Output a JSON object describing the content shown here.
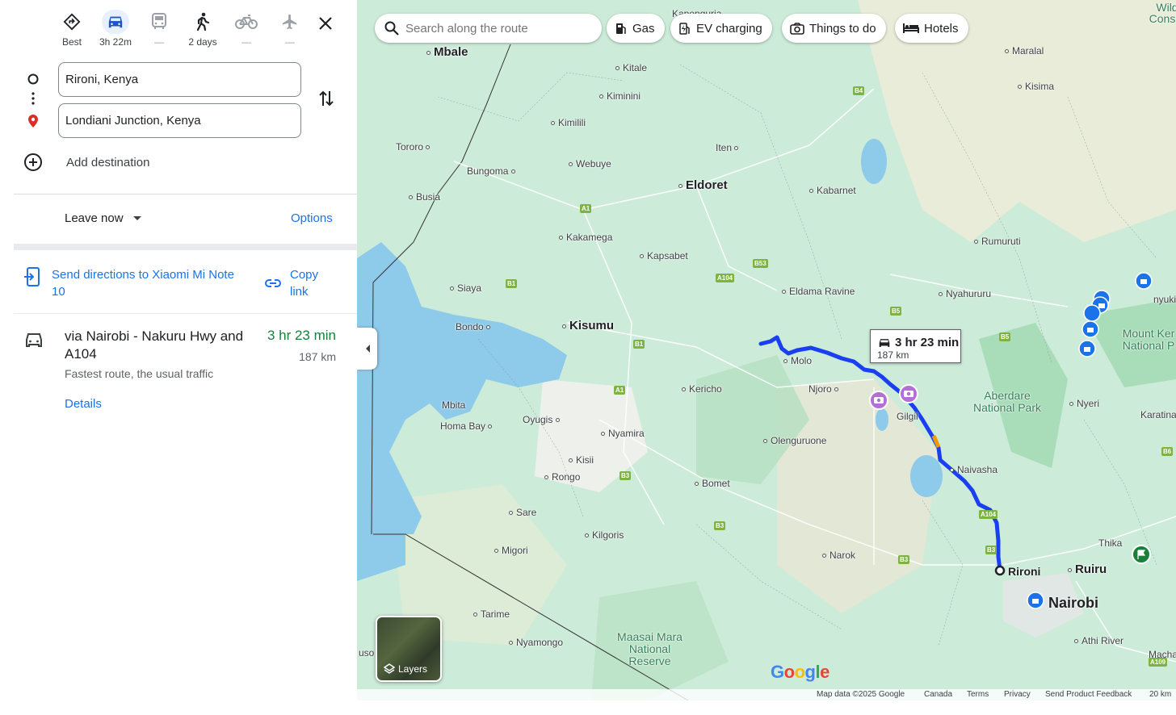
{
  "travel_modes": [
    {
      "name": "best",
      "icon": "best-route-icon",
      "label": "Best",
      "active": false
    },
    {
      "name": "driving",
      "icon": "car-icon",
      "label": "3h 22m",
      "active": true
    },
    {
      "name": "transit",
      "icon": "transit-icon",
      "label": "—",
      "active": false
    },
    {
      "name": "walking",
      "icon": "walking-icon",
      "label": "2 days",
      "active": false
    },
    {
      "name": "cycling",
      "icon": "bicycle-icon",
      "label": "—",
      "active": false
    },
    {
      "name": "flights",
      "icon": "airplane-icon",
      "label": "—",
      "active": false
    }
  ],
  "waypoints": {
    "origin": "Rironi, Kenya",
    "destination": "Londiani Junction, Kenya",
    "add_destination": "Add destination"
  },
  "departure": {
    "leave_label": "Leave now",
    "options_label": "Options"
  },
  "share": {
    "send_label": "Send directions to Xiaomi Mi Note 10",
    "copy_label": "Copy link"
  },
  "route": {
    "name": "via Nairobi - Nakuru Hwy and A104",
    "duration": "3 hr 23 min",
    "distance": "187 km",
    "description": "Fastest route, the usual traffic",
    "details_label": "Details"
  },
  "map": {
    "search_placeholder": "Search along the route",
    "chips": [
      {
        "label": "Gas",
        "icon": "gas-station-icon"
      },
      {
        "label": "EV charging",
        "icon": "ev-charging-icon"
      },
      {
        "label": "Things to do",
        "icon": "camera-icon"
      },
      {
        "label": "Hotels",
        "icon": "bed-icon"
      }
    ],
    "route_callout": {
      "duration": "3 hr 23 min",
      "distance": "187 km"
    },
    "layers_label": "Layers",
    "colors": {
      "route": "#1a3ff0",
      "water": "#8ecae9",
      "land": "#cdebd9",
      "park": "#a9dcb8"
    },
    "places": {
      "mbale": "Mbale",
      "kapenguria": "Kapenguria",
      "kitale": "Kitale",
      "kiminini": "Kiminini",
      "kimilili": "Kimilili",
      "tororo": "Tororo",
      "bungoma": "Bungoma",
      "webuye": "Webuye",
      "busia": "Busia",
      "iten": "Iten",
      "eldoret": "Eldoret",
      "kabarnet": "Kabarnet",
      "kakamega": "Kakamega",
      "kapsabet": "Kapsabet",
      "siaya": "Siaya",
      "bondo": "Bondo",
      "kisumu": "Kisumu",
      "eldama_ravine": "Eldama Ravine",
      "nyahururu": "Nyahururu",
      "rumuruti": "Rumuruti",
      "maralal": "Maralal",
      "kisima": "Kisima",
      "molo": "Molo",
      "njoro": "Njoro",
      "kericho": "Kericho",
      "gilgil": "Gilgil",
      "mbita": "Mbita",
      "homa_bay": "Homa Bay",
      "oyugis": "Oyugis",
      "nyamira": "Nyamira",
      "olenguruone": "Olenguruone",
      "naivasha": "Naivasha",
      "kisii": "Kisii",
      "rongo": "Rongo",
      "bomet": "Bomet",
      "sare": "Sare",
      "kilgoris": "Kilgoris",
      "migori": "Migori",
      "narok": "Narok",
      "rironi": "Rironi",
      "nairobi": "Nairobi",
      "ruiru": "Ruiru",
      "thika": "Thika",
      "nyeri": "Nyeri",
      "karatina": "Karatina",
      "athi_river": "Athi River",
      "tarime": "Tarime",
      "nyamongo": "Nyamongo",
      "nyuki": "nyuki",
      "macha": "Macha",
      "uso": "uso",
      "wild": "Wild",
      "cons": "Cons"
    },
    "parks": {
      "aberdare": "Aberdare National Park",
      "maasai_mara": "Maasai Mara National Reserve",
      "mount_kenya": "Mount Ker National P"
    },
    "highways": [
      "B4",
      "A1",
      "B53",
      "A104",
      "B1",
      "B5",
      "B1",
      "A1",
      "B3",
      "A104",
      "B3",
      "B3",
      "B3",
      "B6",
      "A109"
    ]
  },
  "footer": {
    "map_data": "Map data ©2025 Google",
    "country": "Canada",
    "terms": "Terms",
    "privacy": "Privacy",
    "feedback": "Send Product Feedback",
    "scale": "20 km"
  }
}
